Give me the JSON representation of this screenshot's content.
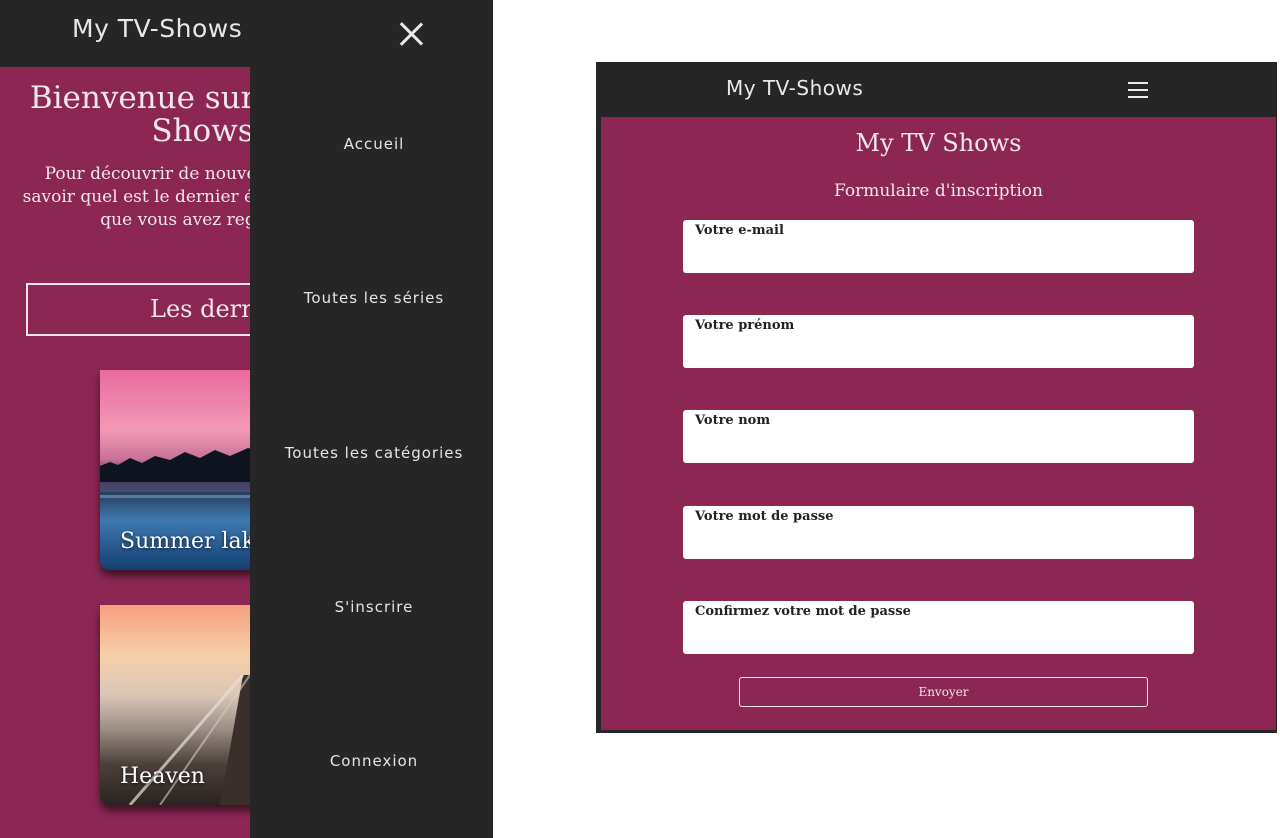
{
  "left_screen": {
    "brand": "My TV-Shows",
    "close_icon": "close-icon",
    "welcome_title": "Bienvenue sur My TV-Shows",
    "welcome_text": "Pour découvrir de nouvelles séries ou savoir quel est le dernier épisode de celles que vous avez regardées",
    "latest_label": "Les dernières séries",
    "cards": [
      {
        "title": "Summer lake"
      },
      {
        "title": "Heaven"
      }
    ],
    "menu": [
      {
        "label": "Accueil"
      },
      {
        "label": "Toutes les séries"
      },
      {
        "label": "Toutes les catégories"
      },
      {
        "label": "S'inscrire"
      },
      {
        "label": "Connexion"
      }
    ]
  },
  "right_screen": {
    "brand": "My TV-Shows",
    "menu_icon": "hamburger-menu-icon",
    "site_title": "My TV Shows",
    "form_title": "Formulaire d'inscription",
    "fields": [
      {
        "label": "Votre e-mail",
        "value": ""
      },
      {
        "label": "Votre prénom",
        "value": ""
      },
      {
        "label": "Votre nom",
        "value": ""
      },
      {
        "label": "Votre mot de passe",
        "value": ""
      },
      {
        "label": "Confirmez votre mot de passe",
        "value": ""
      }
    ],
    "submit_label": "Envoyer"
  },
  "colors": {
    "header_bg": "#262626",
    "accent": "#8c2753",
    "text_light": "#f1e6eb"
  }
}
